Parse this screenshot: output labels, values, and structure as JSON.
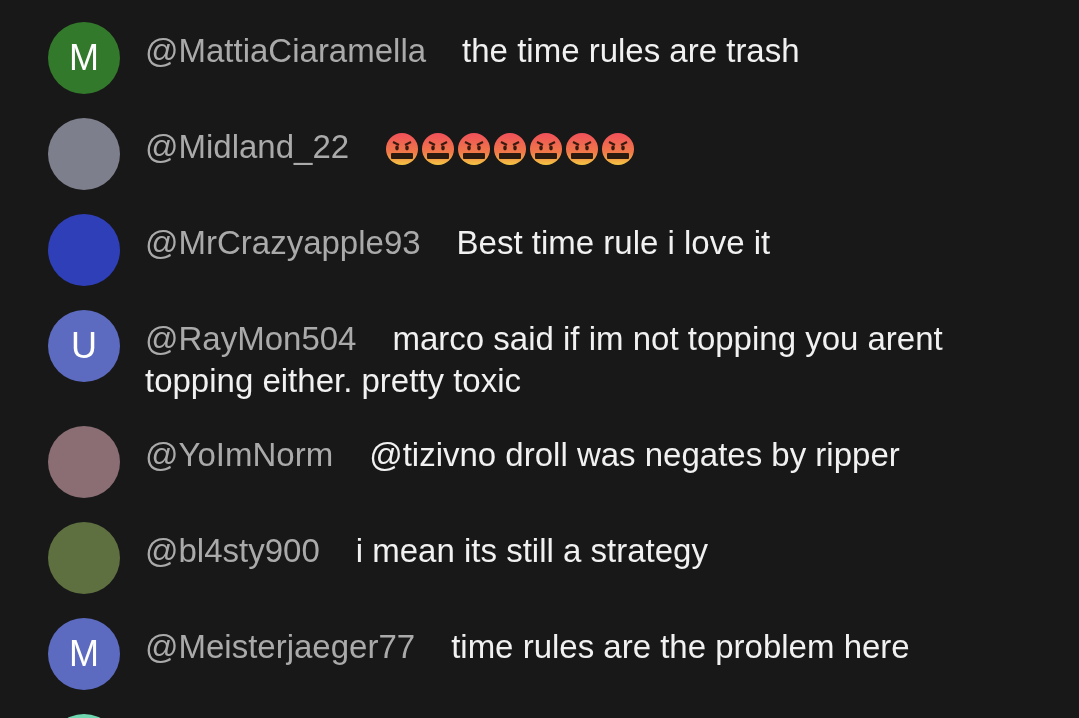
{
  "messages": [
    {
      "avatar": {
        "kind": "letter",
        "letter": "M",
        "color": "#33792b"
      },
      "author": "@MattiaCiaramella",
      "parts": [
        {
          "kind": "text",
          "text": "the time rules are trash"
        }
      ]
    },
    {
      "avatar": {
        "kind": "photo",
        "color": "#7d7f8c"
      },
      "author": "@Midland_22",
      "parts": [
        {
          "kind": "emoji"
        },
        {
          "kind": "emoji"
        },
        {
          "kind": "emoji"
        },
        {
          "kind": "emoji"
        },
        {
          "kind": "emoji"
        },
        {
          "kind": "emoji"
        },
        {
          "kind": "emoji"
        }
      ]
    },
    {
      "avatar": {
        "kind": "photo",
        "color": "#2f3fb8"
      },
      "author": "@MrCrazyapple93",
      "parts": [
        {
          "kind": "text",
          "text": "Best time rule i love it"
        }
      ]
    },
    {
      "avatar": {
        "kind": "letter",
        "letter": "U",
        "color": "#5c6bc0"
      },
      "author": "@RayMon504",
      "parts": [
        {
          "kind": "text",
          "text": "marco said if im not topping you arent topping either. pretty toxic"
        }
      ]
    },
    {
      "avatar": {
        "kind": "photo",
        "color": "#8a6e74"
      },
      "author": "@YoImNorm",
      "parts": [
        {
          "kind": "text",
          "text": "@tizivno droll was negates by ripper"
        }
      ]
    },
    {
      "avatar": {
        "kind": "photo",
        "color": "#5e7040"
      },
      "author": "@bl4sty900",
      "parts": [
        {
          "kind": "text",
          "text": "i mean its still a strategy"
        }
      ]
    },
    {
      "avatar": {
        "kind": "letter",
        "letter": "M",
        "color": "#5c6bc0"
      },
      "author": "@Meisterjaeger77",
      "parts": [
        {
          "kind": "text",
          "text": "time rules are the problem here"
        }
      ]
    },
    {
      "avatar": {
        "kind": "photo",
        "color": "#6fd6b0"
      }
    }
  ]
}
